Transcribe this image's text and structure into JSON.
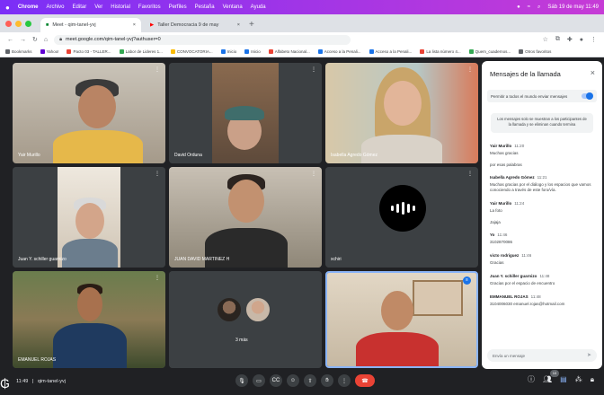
{
  "menubar": {
    "app": "Chrome",
    "items": [
      "Archivo",
      "Editar",
      "Ver",
      "Historial",
      "Favoritos",
      "Perfiles",
      "Pestaña",
      "Ventana",
      "Ayuda"
    ],
    "clock": "Sáb 19 de may 11:49"
  },
  "tabs": [
    {
      "label": "Meet - qim-tanel-yvj",
      "active": true
    },
    {
      "label": "Taller Democracia 9 de may",
      "active": false
    }
  ],
  "address": {
    "url": "meet.google.com/qim-tanel-yvj?authuser=0"
  },
  "bookmarks": [
    {
      "label": "Bookmarks",
      "color": "#5f6368"
    },
    {
      "label": "Yahoo!",
      "color": "#6001d2"
    },
    {
      "label": "Pacto 03 - TALLER...",
      "color": "#ea4335"
    },
    {
      "label": "Labor de Lideres 1...",
      "color": "#34a853"
    },
    {
      "label": "CONVOCATORIA...",
      "color": "#fbbc04"
    },
    {
      "label": "Inicio",
      "color": "#1a73e8"
    },
    {
      "label": "Inicio",
      "color": "#1a73e8"
    },
    {
      "label": "Alfabeto Nacional...",
      "color": "#ea4335"
    },
    {
      "label": "Acceso a la Penali...",
      "color": "#1a73e8"
    },
    {
      "label": "Acceso a la Penali...",
      "color": "#1a73e8"
    },
    {
      "label": "La lista número 4...",
      "color": "#ea4335"
    },
    {
      "label": "Quem_cuadernos...",
      "color": "#34a853"
    },
    {
      "label": "Otros favoritos",
      "color": "#5f6368"
    }
  ],
  "participants": [
    {
      "name": "Yair Murillo"
    },
    {
      "name": "David Orduna"
    },
    {
      "name": "Isabella Agredo Gómez"
    },
    {
      "name": "Juan Y. schiller guarnizo"
    },
    {
      "name": "JUAN DAVID MARTINEZ H"
    },
    {
      "name": "xchiri"
    },
    {
      "name": "EMANUEL ROJAS"
    },
    {
      "name": "3 más"
    },
    {
      "name": ""
    }
  ],
  "chat": {
    "title": "Mensajes de la llamada",
    "toggle_label": "Permitir a todos el mundo enviar mensajes",
    "notice": "Los mensajes solo se muestran a los participantes de la llamada y se eliminan cuando termina",
    "messages": [
      {
        "author": "Yair Murillo",
        "time": "11:20",
        "text": "Muchas gracias",
        "text2": "por esas palabras"
      },
      {
        "author": "Isabella Agredo Gómez",
        "time": "11:21",
        "text": "Muchas gracias por el diálogo y los espacios que vamos conociendo a través de este foro/vía.",
        "text2": ""
      },
      {
        "author": "Yair Murillo",
        "time": "11:24",
        "text": "La foto",
        "text2": "Jajaja"
      },
      {
        "author": "Yo",
        "time": "11:46",
        "text": "3102870086",
        "text2": ""
      },
      {
        "author": "victo rodriguez",
        "time": "11:46",
        "text": "Gracias",
        "text2": ""
      },
      {
        "author": "Juan Y. schiller guarnizo",
        "time": "11:48",
        "text": "Gracias por el espacio de encuentro",
        "text2": ""
      },
      {
        "author": "EMMANUEL ROJAS",
        "time": "11:48",
        "text": "3104006030 emanuel.rojas@hotmail.com",
        "text2": ""
      }
    ],
    "input_placeholder": "Envía un mensaje"
  },
  "bottom": {
    "time": "11:49",
    "meeting_code": "qim-tanel-yvj",
    "people_count": "10"
  },
  "colors": {
    "accent": "#1a73e8",
    "end_call": "#ea4335",
    "background": "#202124",
    "tile": "#3c4043"
  }
}
